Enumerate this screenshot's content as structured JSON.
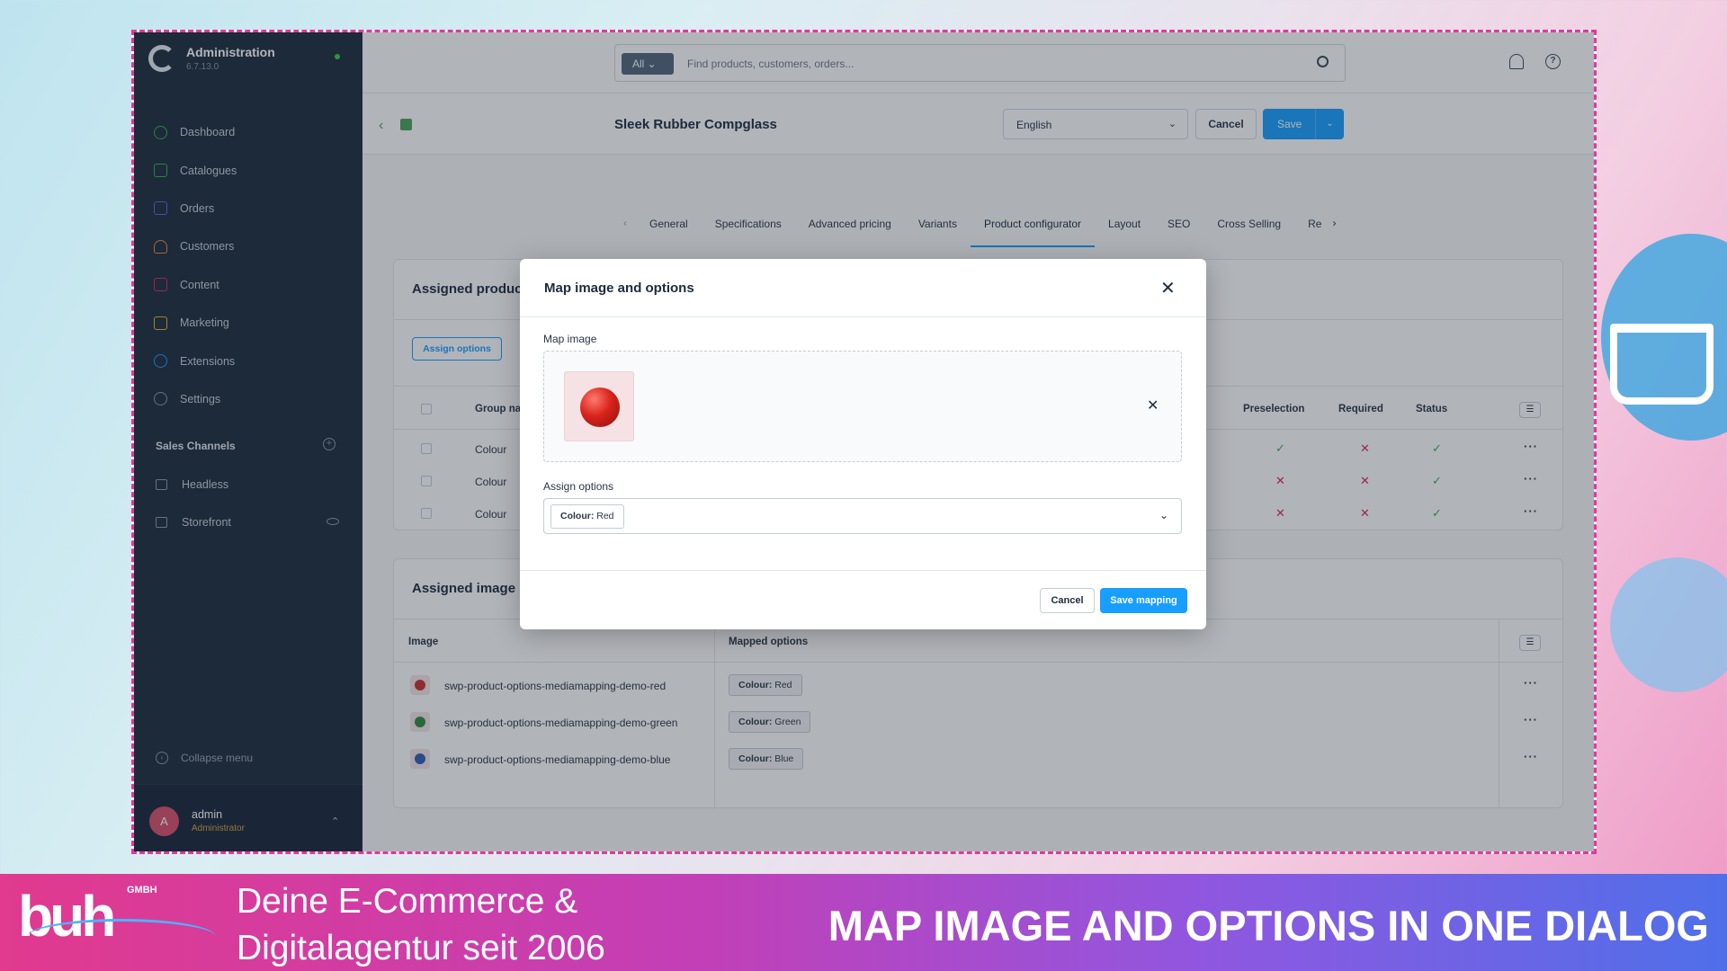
{
  "sidebar": {
    "app_title": "Administration",
    "version": "6.7.13.0",
    "nav": [
      {
        "label": "Dashboard",
        "color": "#37b24d"
      },
      {
        "label": "Catalogues",
        "color": "#37b24d"
      },
      {
        "label": "Orders",
        "color": "#6c5ce7"
      },
      {
        "label": "Customers",
        "color": "#f08a24"
      },
      {
        "label": "Content",
        "color": "#de294c"
      },
      {
        "label": "Marketing",
        "color": "#e6b81e"
      },
      {
        "label": "Extensions",
        "color": "#189eff"
      },
      {
        "label": "Settings",
        "color": "#8c98a7"
      }
    ],
    "sales_channels_title": "Sales Channels",
    "sales_channels": [
      {
        "label": "Headless"
      },
      {
        "label": "Storefront"
      }
    ],
    "collapse_label": "Collapse menu",
    "user": {
      "initial": "A",
      "name": "admin",
      "role": "Administrator"
    }
  },
  "topbar": {
    "search_scope": "All",
    "search_placeholder": "Find products, customers, orders..."
  },
  "page": {
    "title": "Sleek Rubber Compglass",
    "language": "English",
    "cancel_label": "Cancel",
    "save_label": "Save"
  },
  "tabs": [
    {
      "label": "General"
    },
    {
      "label": "Specifications"
    },
    {
      "label": "Advanced pricing"
    },
    {
      "label": "Variants"
    },
    {
      "label": "Product configurator",
      "active": true
    },
    {
      "label": "Layout"
    },
    {
      "label": "SEO"
    },
    {
      "label": "Cross Selling"
    },
    {
      "label": "Re"
    }
  ],
  "assigned_options_card": {
    "title": "Assigned produc",
    "assign_button": "Assign options",
    "columns": {
      "group": "Group na",
      "preselection": "Preselection",
      "required": "Required",
      "status": "Status"
    },
    "rows": [
      {
        "group": "Colour",
        "preselection": true,
        "required": false,
        "status": true
      },
      {
        "group": "Colour",
        "preselection": false,
        "required": false,
        "status": true
      },
      {
        "group": "Colour",
        "preselection": false,
        "required": false,
        "status": true
      }
    ]
  },
  "assigned_images_card": {
    "title": "Assigned image",
    "columns": {
      "image": "Image",
      "mapped": "Mapped options"
    },
    "rows": [
      {
        "name": "swp-product-options-mediamapping-demo-red",
        "group": "Colour:",
        "value": "Red",
        "color": "#c9302c"
      },
      {
        "name": "swp-product-options-mediamapping-demo-green",
        "group": "Colour:",
        "value": "Green",
        "color": "#2e8b3a"
      },
      {
        "name": "swp-product-options-mediamapping-demo-blue",
        "group": "Colour:",
        "value": "Blue",
        "color": "#2f5fb3"
      }
    ]
  },
  "modal": {
    "title": "Map image and options",
    "map_image_label": "Map image",
    "assign_options_label": "Assign options",
    "selected_group": "Colour:",
    "selected_value": "Red",
    "cancel_label": "Cancel",
    "save_label": "Save mapping"
  },
  "banner": {
    "logo": "buh",
    "logo_suffix": "GMBH",
    "tagline_1": "Deine E-Commerce &",
    "tagline_2": "Digitalagentur seit 2006",
    "headline": "MAP IMAGE AND OPTIONS IN ONE DIALOG"
  }
}
